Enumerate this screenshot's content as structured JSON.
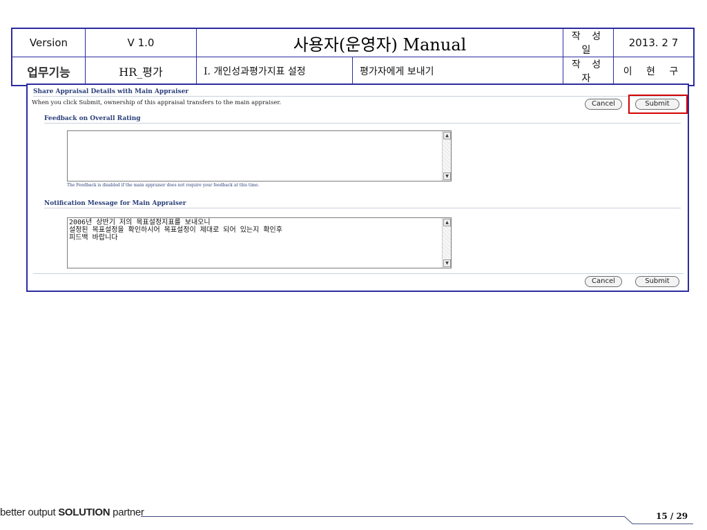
{
  "header": {
    "version_label": "Version",
    "version_value": "V 1.0",
    "title": "사용자(운영자) Manual",
    "date_label": "작 성 일",
    "date_value": "2013.  2  7",
    "function_label": "업무기능",
    "function_value": "HR_평가",
    "section": "Ⅰ. 개인성과평가지표 설정",
    "subsection": "평가자에게 보내기",
    "author_label": "작 성 자",
    "author_value": "이 현 구"
  },
  "screen": {
    "title": "Share Appraisal Details with Main Appraiser",
    "instruction": "When you click Submit, ownership of this appraisal transfers to the main appraiser.",
    "feedback_title": "Feedback on Overall Rating",
    "feedback_value": "",
    "feedback_note": "The Feedback is disabled if the main appraiser does not require your feedback at this time.",
    "notification_title": "Notification Message for Main Appraiser",
    "notification_value": "2006년 상반기 저의 목표설정지표를 보내오니\n설정된 목표설정을 확인하시어 목표설정이 제대로 되어 있는지 확인후\n피드백 바랍니다",
    "cancel_label": "Cancel",
    "submit_label": "Submit"
  },
  "footer": {
    "brand_prefix": "better output ",
    "brand_bold": "SOLUTION",
    "brand_suffix": " partner",
    "page": "15 / 29"
  },
  "colors": {
    "frame_blue": "#2a2aa0",
    "highlight_red": "#d40000",
    "section_title": "#2b3f7a"
  }
}
